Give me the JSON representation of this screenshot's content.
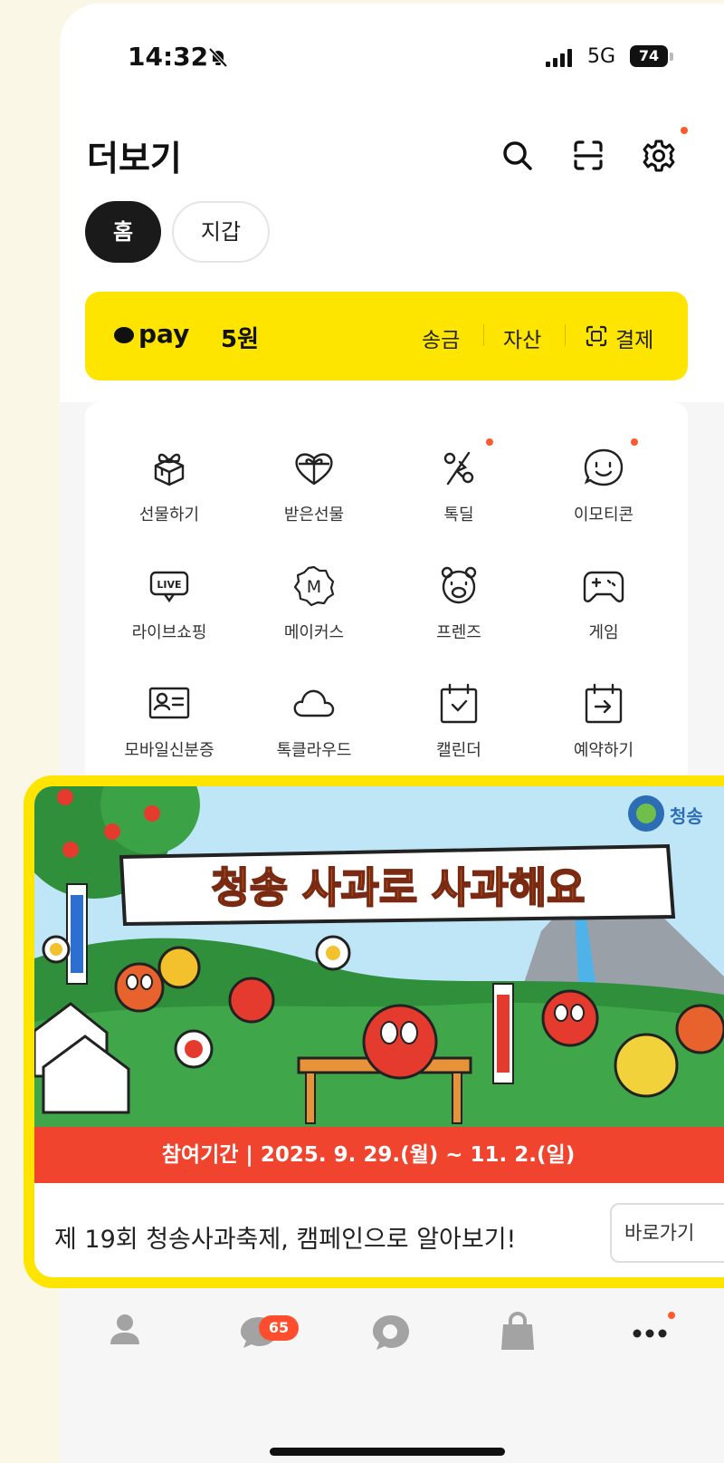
{
  "status_bar": {
    "time": "14:32",
    "network": "5G",
    "battery": "74"
  },
  "header": {
    "title": "더보기"
  },
  "chips": [
    "홈",
    "지갑"
  ],
  "pay": {
    "logo": "pay",
    "balance": "5원",
    "links": [
      "송금",
      "자산",
      "결제"
    ]
  },
  "menu": [
    {
      "label": "선물하기",
      "icon": "gift-box-icon",
      "dot": false
    },
    {
      "label": "받은선물",
      "icon": "received-gift-icon",
      "dot": false
    },
    {
      "label": "톡딜",
      "icon": "percent-deal-icon",
      "dot": true
    },
    {
      "label": "이모티콘",
      "icon": "smile-emoticon-icon",
      "dot": true
    },
    {
      "label": "라이브쇼핑",
      "icon": "live-shopping-icon",
      "dot": false
    },
    {
      "label": "메이커스",
      "icon": "makers-m-icon",
      "dot": false
    },
    {
      "label": "프렌즈",
      "icon": "friends-face-icon",
      "dot": false
    },
    {
      "label": "게임",
      "icon": "gamepad-icon",
      "dot": false
    },
    {
      "label": "모바일신분증",
      "icon": "id-card-icon",
      "dot": false
    },
    {
      "label": "톡클라우드",
      "icon": "cloud-icon",
      "dot": false
    },
    {
      "label": "캘린더",
      "icon": "calendar-icon",
      "dot": false
    },
    {
      "label": "예약하기",
      "icon": "reservation-icon",
      "dot": false
    }
  ],
  "banner": {
    "headline": "청송 사과로 사과해요",
    "sponsor": "청송",
    "period": "참여기간 | 2025. 9. 29.(월) ~ 11. 2.(일)",
    "caption": "제 19회 청송사과축제, 캠페인으로 알아보기!",
    "button": "바로가기"
  },
  "tabbar": {
    "chats_badge": "65"
  },
  "colors": {
    "kakao_yellow": "#fde500",
    "accent_red": "#f0442f",
    "dot_orange": "#ff5a2c"
  }
}
